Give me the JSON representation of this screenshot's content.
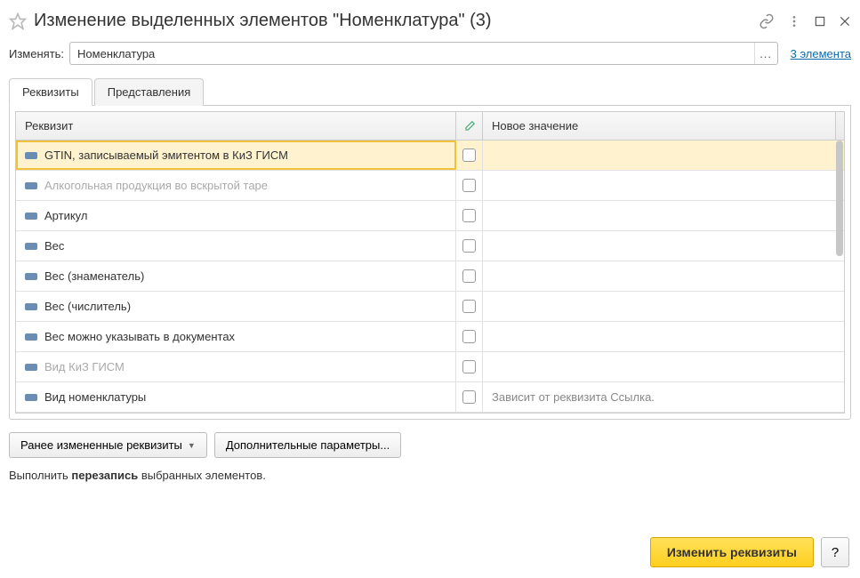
{
  "header": {
    "title": "Изменение выделенных элементов \"Номенклатура\" (3)"
  },
  "change": {
    "label": "Изменять:",
    "value": "Номенклатура",
    "dots": "...",
    "link": "3 элемента"
  },
  "tabs": [
    {
      "label": "Реквизиты",
      "active": true
    },
    {
      "label": "Представления",
      "active": false
    }
  ],
  "table": {
    "headers": {
      "req": "Реквизит",
      "val": "Новое значение"
    },
    "rows": [
      {
        "label": "GTIN, записываемый эмитентом в КиЗ ГИСМ",
        "disabled": false,
        "selected": true,
        "val": ""
      },
      {
        "label": "Алкогольная продукция во вскрытой таре",
        "disabled": true,
        "selected": false,
        "val": ""
      },
      {
        "label": "Артикул",
        "disabled": false,
        "selected": false,
        "val": ""
      },
      {
        "label": "Вес",
        "disabled": false,
        "selected": false,
        "val": ""
      },
      {
        "label": "Вес (знаменатель)",
        "disabled": false,
        "selected": false,
        "val": ""
      },
      {
        "label": "Вес (числитель)",
        "disabled": false,
        "selected": false,
        "val": ""
      },
      {
        "label": "Вес можно указывать в документах",
        "disabled": false,
        "selected": false,
        "val": ""
      },
      {
        "label": "Вид КиЗ ГИСМ",
        "disabled": true,
        "selected": false,
        "val": ""
      },
      {
        "label": "Вид номенклатуры",
        "disabled": false,
        "selected": false,
        "val": "Зависит от реквизита Ссылка."
      }
    ]
  },
  "footer": {
    "prev_changed": "Ранее измененные реквизиты",
    "extra_params": "Дополнительные параметры...",
    "text_prefix": "Выполнить ",
    "text_bold": "перезапись",
    "text_suffix": " выбранных элементов."
  },
  "actions": {
    "primary": "Изменить реквизиты",
    "help": "?"
  }
}
